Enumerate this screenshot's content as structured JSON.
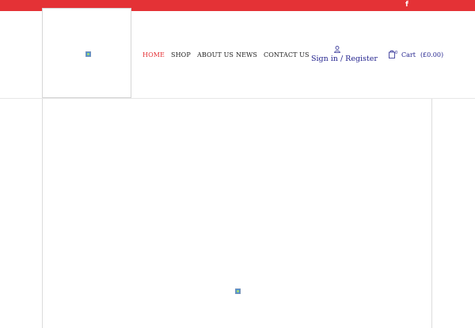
{
  "topbar": {
    "social_icon": "facebook-icon",
    "color": "#e43236"
  },
  "logo": {
    "image": "broken-image-icon"
  },
  "nav": {
    "items": [
      {
        "label": "HOME",
        "active": true
      },
      {
        "label": "SHOP",
        "active": false
      },
      {
        "label": "ABOUT US",
        "active": false
      },
      {
        "label": "NEWS",
        "active": false
      },
      {
        "label": "CONTACT US",
        "active": false
      }
    ]
  },
  "account": {
    "icon": "user-icon",
    "label": "Sign in / Register"
  },
  "cart": {
    "icon": "shopping-bag-icon",
    "count": "0",
    "label": "Cart",
    "total": "(£0.00)"
  },
  "hero": {
    "image": "broken-image-icon"
  },
  "colors": {
    "accent": "#e43236",
    "link": "#23238e"
  }
}
